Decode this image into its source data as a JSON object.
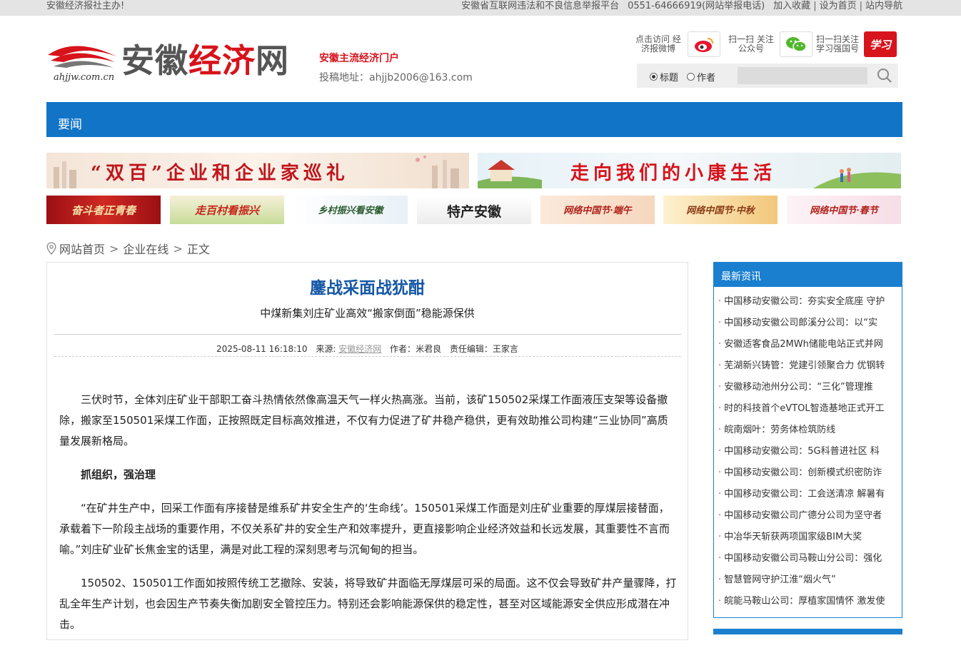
{
  "topbar": {
    "left": "安徽经济报社主办!",
    "platform": "安徽省互联网违法和不良信息举报平台",
    "phone": "0551-64666919(网站举报电话)",
    "links": [
      "加入收藏",
      "设为首页",
      "站内导航"
    ]
  },
  "header": {
    "logo_domain": "ahjjw.com.cn",
    "logo_text_a": "安徽",
    "logo_text_b": "经济",
    "logo_text_c": "网",
    "slogan": "安徽主流经济门户",
    "submit": "投稿地址：ahjjb2006@163.com",
    "weibo_text": "点击访问 经济报微博",
    "wechat_text": "扫一扫 关注公众号",
    "xuexi_text": "扫一扫关注 学习强国号",
    "xuexi_logo": "学习"
  },
  "search": {
    "opt_title": "标题",
    "opt_author": "作者",
    "placeholder": ""
  },
  "nav": {
    "item": "要闻"
  },
  "banners": {
    "big1": "“双百”企业和企业家巡礼",
    "big2": "走向我们的小康生活",
    "small": [
      "奋斗者正青春",
      "走百村看振兴",
      "乡村振兴看安徽",
      "特产安徽",
      "网络中国节·端午",
      "网络中国节·中秋",
      "网络中国节·春节"
    ]
  },
  "breadcrumb": {
    "home": "网站首页",
    "section": "企业在线",
    "current": "正文"
  },
  "article": {
    "title": "鏖战采面战犹酣",
    "subtitle": "中煤新集刘庄矿业高效“搬家倒面”稳能源保供",
    "datetime": "2025-08-11 16:18:10",
    "source_label": "来源:",
    "source": "安徽经济网",
    "author_label": "作者：",
    "author": "米君良",
    "editor_label": "责任编辑：",
    "editor": "王家言",
    "p1": "三伏时节，全体刘庄矿业干部职工奋斗热情依然像高温天气一样火热高涨。当前，该矿150502采煤工作面液压支架等设备撤除，搬家至150501采煤工作面，正按照既定目标高效推进，不仅有力促进了矿井稳产稳供，更有效助推公司构建“三业协同”高质量发展新格局。",
    "h1": "抓组织，强治理",
    "p2": "“在矿井生产中，回采工作面有序接替是维系矿井安全生产的‘生命线’。150501采煤工作面是刘庄矿业重要的厚煤层接替面，承载着下一阶段主战场的重要作用，不仅关系矿井的安全生产和效率提升，更直接影响企业经济效益和长远发展，其重要性不言而喻。”刘庄矿业矿长焦金宝的话里，满是对此工程的深刻思考与沉甸甸的担当。",
    "p3": "150502、150501工作面如按照传统工艺撤除、安装，将导致矿井面临无厚煤层可采的局面。这不仅会导致矿井产量骤降，打乱全年生产计划，也会因生产节奏失衡加剧安全管控压力。特别还会影响能源保供的稳定性，甚至对区域能源安全供应形成潜在冲击。"
  },
  "sidebar": {
    "title": "最新资讯",
    "items": [
      "中国移动安徽公司：夯实安全底座 守护",
      "中国移动安徽公司郎溪分公司：以“实",
      "安徽适客食品2MWh储能电站正式并网",
      "芜湖新兴铸管：党建引领聚合力 优钢转",
      "安徽移动池州分公司：“三化”管理推",
      "时的科技首个eVTOL智造基地正式开工",
      "皖南烟叶：劳务体检筑防线",
      "中国移动安徽公司：5G科普进社区 科",
      "中国移动安徽公司：创新模式织密防诈",
      "中国移动安徽公司：工会送清凉 解暑有",
      "中国移动安徽公司广德分公司为坚守者",
      "中冶华天斩获两项国家级BIM大奖",
      "中国移动安徽公司马鞍山分公司：强化",
      "智慧管网守护江淮“烟火气”",
      "皖能马鞍山公司：厚植家国情怀 激发使"
    ]
  },
  "colors": {
    "brand_red": "#d7131b",
    "nav_blue": "#1174c7",
    "title_blue": "#1557a6"
  }
}
